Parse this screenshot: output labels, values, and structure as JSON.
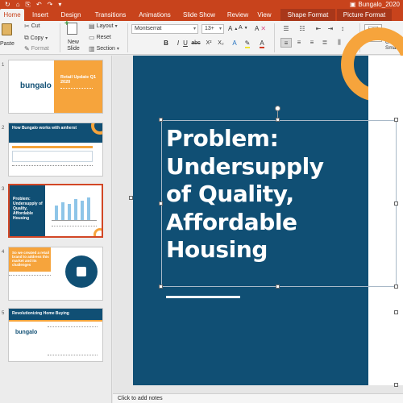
{
  "window": {
    "doc_title": "Bungalo_2020",
    "quick_access": [
      "↻",
      "⌂",
      "⎘",
      "↶",
      "↷",
      "▾"
    ]
  },
  "ribbon_tabs": [
    "Home",
    "Insert",
    "Design",
    "Transitions",
    "Animations",
    "Slide Show",
    "Review",
    "View",
    "Shape Format",
    "Picture Format"
  ],
  "clipboard": {
    "paste": "Paste",
    "cut": "Cut",
    "copy": "Copy",
    "format": "Format"
  },
  "slides_group": {
    "new_slide": "New Slide",
    "layout": "Layout",
    "reset": "Reset",
    "section": "Section"
  },
  "font": {
    "name": "Montserrat",
    "size": "13+",
    "bold": "B",
    "italic": "I",
    "underline": "U",
    "strike": "abc",
    "superscript": "X²",
    "subscript": "X₂"
  },
  "shapes_label": "Convert to SmartArt",
  "thumbnails": [
    {
      "num": "1",
      "title": "Retail Update Q1 2020",
      "logo": "bungalo"
    },
    {
      "num": "2",
      "title": "How Bungalo works with amherst"
    },
    {
      "num": "3",
      "title": "Problem: Undersupply of Quality, Affordable Housing"
    },
    {
      "num": "4",
      "title": "So we created a retail brand to address this market and its challenges"
    },
    {
      "num": "5",
      "title": "Revolutionizing Home Buying",
      "logo": "bungalo"
    }
  ],
  "slide": {
    "title_lines": [
      "Problem:",
      "Undersupply",
      "of Quality,",
      "Affordable",
      "Housing"
    ]
  },
  "notes_placeholder": "Click to add notes",
  "colors": {
    "ribbon": "#c8431c",
    "slide_bg": "#104f74",
    "accent": "#f6a43c"
  }
}
